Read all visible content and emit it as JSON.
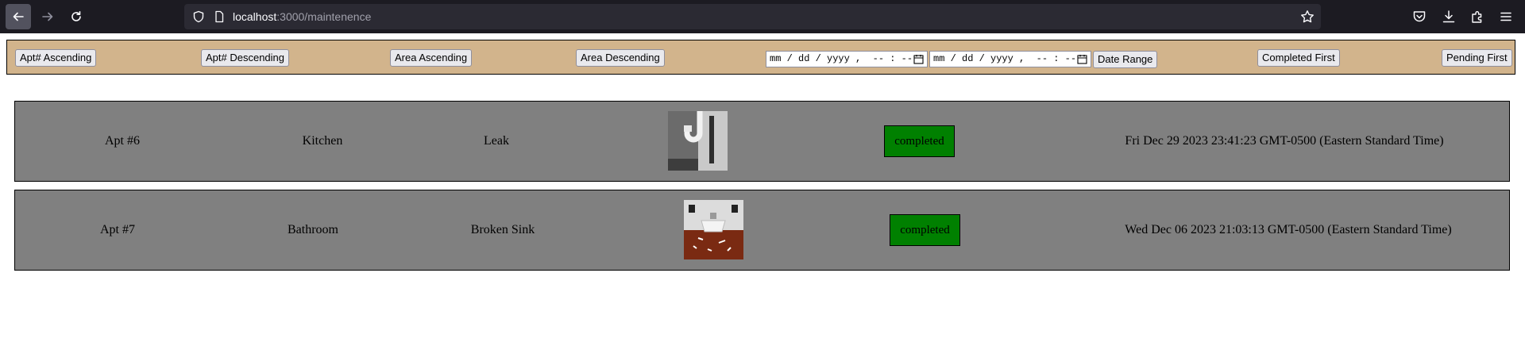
{
  "browser": {
    "url_host": "localhost",
    "url_path": ":3000/maintenence"
  },
  "sortbar": {
    "apt_asc": "Apt# Ascending",
    "apt_desc": "Apt# Descending",
    "area_asc": "Area Ascending",
    "area_desc": "Area Descending",
    "date_start_placeholder": "mm / dd / yyyy ,  -- : --   --",
    "date_end_placeholder": "mm / dd / yyyy ,  -- : --   --",
    "date_range": "Date Range",
    "completed_first": "Completed First",
    "pending_first": "Pending First"
  },
  "requests": [
    {
      "apt": "Apt #6",
      "area": "Kitchen",
      "issue": "Leak",
      "image": "sink-pipe-leak-photo",
      "status": "completed",
      "date": "Fri Dec 29 2023 23:41:23 GMT-0500 (Eastern Standard Time)"
    },
    {
      "apt": "Apt #7",
      "area": "Bathroom",
      "issue": "Broken Sink",
      "image": "broken-sink-photo",
      "status": "completed",
      "date": "Wed Dec 06 2023 21:03:13 GMT-0500 (Eastern Standard Time)"
    }
  ],
  "colors": {
    "sortbar_bg": "#d2b48c",
    "row_bg": "#808080",
    "status_completed": "#008000",
    "chrome_bg": "#1c1b22"
  }
}
